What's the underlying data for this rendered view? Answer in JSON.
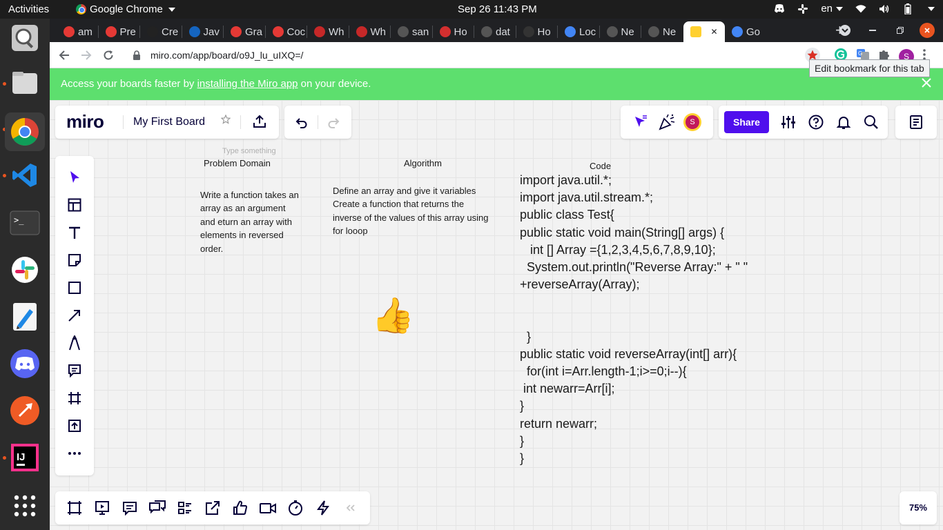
{
  "os": {
    "activities": "Activities",
    "app_name": "Google Chrome",
    "clock": "Sep 26  11:43 PM",
    "lang": "en"
  },
  "browser": {
    "tabs": [
      {
        "label": "am",
        "color": "#e53935"
      },
      {
        "label": "Pre",
        "color": "#e53935"
      },
      {
        "label": "Cre",
        "color": "#222222"
      },
      {
        "label": "Jav",
        "color": "#1565c0"
      },
      {
        "label": "Gra",
        "color": "#e53935"
      },
      {
        "label": "Coc",
        "color": "#e53935"
      },
      {
        "label": "Wh",
        "color": "#c62828"
      },
      {
        "label": "Wh",
        "color": "#c62828"
      },
      {
        "label": "san",
        "color": "#555555"
      },
      {
        "label": "Ho",
        "color": "#d32f2f"
      },
      {
        "label": "dat",
        "color": "#555555"
      },
      {
        "label": "Ho",
        "color": "#333333"
      },
      {
        "label": "Loc",
        "color": "#4285f4"
      },
      {
        "label": "Ne",
        "color": "#555555"
      },
      {
        "label": "Ne",
        "color": "#555555"
      },
      {
        "label": "",
        "color": "#ffd02f",
        "active": true
      },
      {
        "label": "Go",
        "color": "#4285f4"
      }
    ],
    "new_tab": "+",
    "url": "miro.com/app/board/o9J_lu_uIXQ=/",
    "tooltip": "Edit bookmark for this tab",
    "profile_initial": "S"
  },
  "banner": {
    "prefix": "Access your boards faster by ",
    "link": "installing the Miro app",
    "suffix": " on your device."
  },
  "miro": {
    "logo": "miro",
    "board_name": "My First Board",
    "share": "Share",
    "avatar_initial": "S",
    "zoom": "75%",
    "accent": "#4f0fed"
  },
  "board": {
    "placeholder": "Type something",
    "col_problem": "Problem Domain",
    "col_algorithm": "Algorithm",
    "col_code": "Code",
    "problem_lines": [
      "Write a function takes an",
      "array as an argument",
      "and eturn an array with",
      "elements in reversed",
      "order."
    ],
    "algorithm_lines": [
      "Define an array and give it variables",
      "Create a function that returns the",
      "inverse of the values of this array using",
      "for looop"
    ],
    "code_lines": [
      "import java.util.*;",
      "import java.util.stream.*;",
      "public class Test{",
      "public static void main(String[] args) {",
      "   int [] Array ={1,2,3,4,5,6,7,8,9,10};",
      "  System.out.println(\"Reverse Array:\" + \" \"",
      "+reverseArray(Array);",
      "",
      "",
      "  }",
      "public static void reverseArray(int[] arr){",
      "  for(int i=Arr.length-1;i>=0;i--){",
      " int newarr=Arr[i];",
      "}",
      "return newarr;",
      "}",
      "}"
    ],
    "emoji": "👍"
  }
}
